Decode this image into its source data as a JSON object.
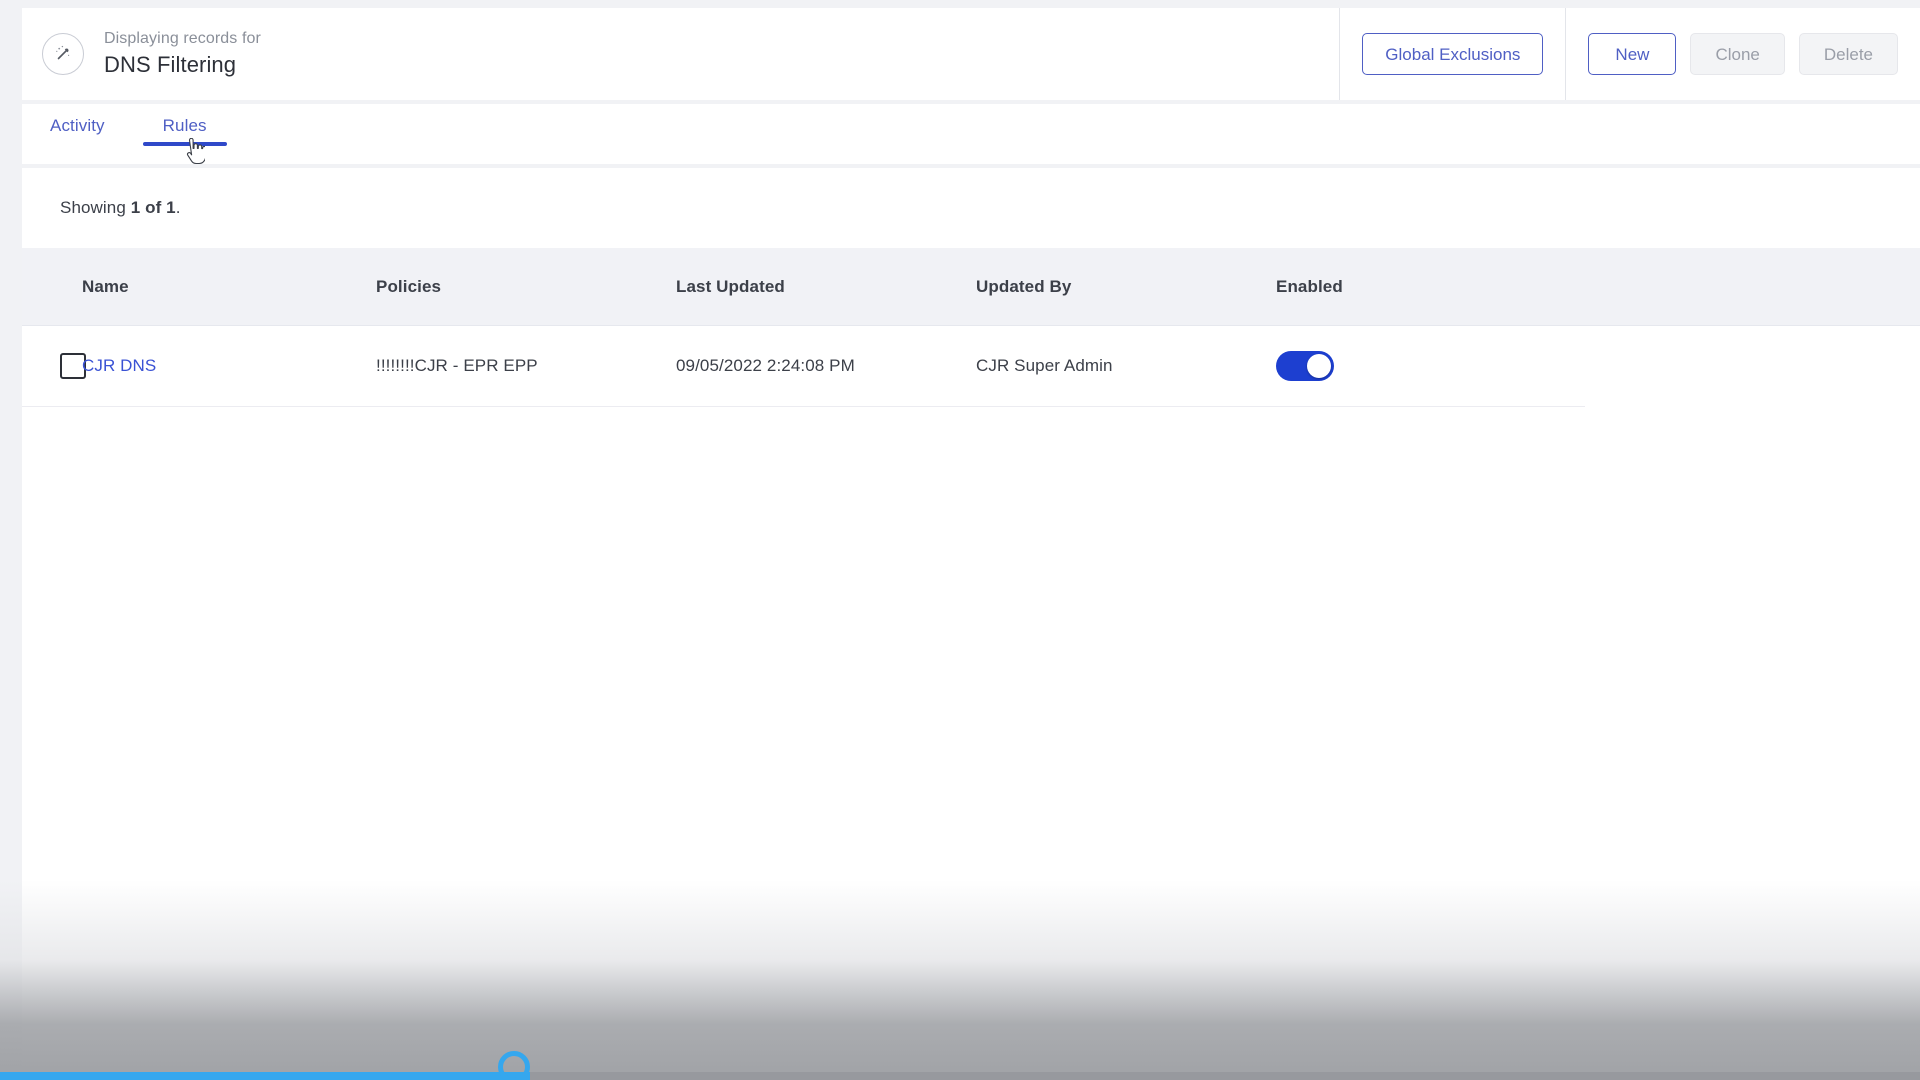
{
  "header": {
    "icon": "magic-wand-icon",
    "kicker": "Displaying records for",
    "title": "DNS Filtering",
    "global_exclusions_label": "Global Exclusions",
    "new_label": "New",
    "clone_label": "Clone",
    "delete_label": "Delete"
  },
  "tabs": [
    {
      "label": "Activity",
      "active": false
    },
    {
      "label": "Rules",
      "active": true
    }
  ],
  "summary": {
    "prefix": "Showing ",
    "count": "1 of 1",
    "suffix": "."
  },
  "table": {
    "columns": [
      {
        "key": "name",
        "label": "Name"
      },
      {
        "key": "policies",
        "label": "Policies"
      },
      {
        "key": "last_updated",
        "label": "Last Updated"
      },
      {
        "key": "updated_by",
        "label": "Updated By"
      },
      {
        "key": "enabled",
        "label": "Enabled"
      }
    ],
    "rows": [
      {
        "selected": false,
        "name": "CJR DNS",
        "policies": "!!!!!!!!CJR - EPR EPP",
        "last_updated": "09/05/2022 2:24:08 PM",
        "updated_by": "CJR Super Admin",
        "enabled": true
      }
    ]
  },
  "colors": {
    "accent_blue": "#4f5fc4",
    "link_blue": "#3a52d4",
    "tab_underline": "#2f49c9",
    "toggle_on": "#1d3fd0",
    "progress_blue": "#35a7ee",
    "header_row_bg": "#f1f2f6",
    "page_bg": "#f1f2f5"
  },
  "progress": {
    "value_percent": 28
  }
}
